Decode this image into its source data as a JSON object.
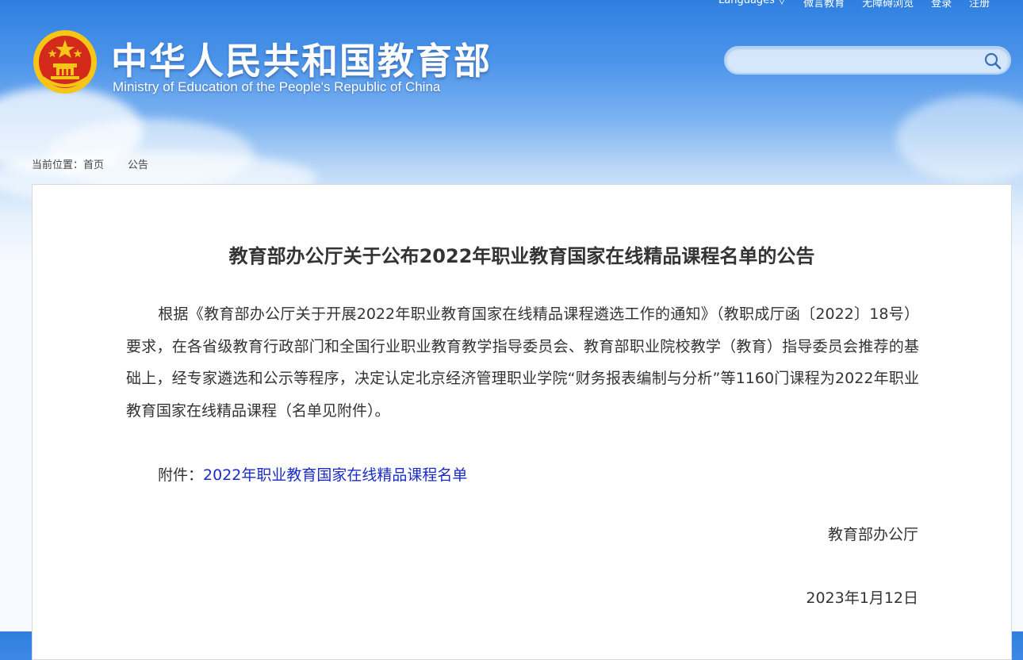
{
  "header": {
    "title_cn": "中华人民共和国教育部",
    "title_en": "Ministry of Education of the People's Republic of China",
    "nav": [
      "Languages ▽",
      "微言教育",
      "无障碍浏览",
      "登录",
      "注册"
    ],
    "search": {
      "placeholder": ""
    }
  },
  "breadcrumb": {
    "prefix": "当前位置：",
    "home": "首页",
    "current": "公告"
  },
  "article": {
    "title": "教育部办公厅关于公布2022年职业教育国家在线精品课程名单的公告",
    "body": "根据《教育部办公厅关于开展2022年职业教育国家在线精品课程遴选工作的通知》（教职成厅函〔2022〕18号）要求，在各省级教育行政部门和全国行业职业教育教学指导委员会、教育部职业院校教学（教育）指导委员会推荐的基础上，经专家遴选和公示等程序，决定认定北京经济管理职业学院“财务报表编制与分析”等1160门课程为2022年职业教育国家在线精品课程（名单见附件）。",
    "attachment_label": "附件：",
    "attachment_link": "2022年职业教育国家在线精品课程名单",
    "signature": "教育部办公厅",
    "date": "2023年1月12日"
  },
  "colors": {
    "sky_top": "#2f7fe0",
    "link": "#1a2cc8",
    "text": "#333333",
    "emblem_red": "#d42a1c",
    "emblem_gold": "#f5c518"
  }
}
